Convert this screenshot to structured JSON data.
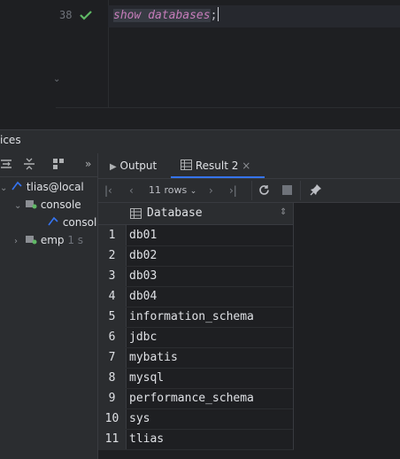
{
  "editor": {
    "line_number": "38",
    "code_keyword": "show databases",
    "code_semicolon": ";"
  },
  "services": {
    "title": "ices",
    "tree": [
      {
        "label": "tlias@local",
        "icon": "connection-icon"
      },
      {
        "label": "console",
        "icon": "console-icon"
      },
      {
        "label": "consol",
        "icon": "console-leaf-icon"
      },
      {
        "label": "emp",
        "icon": "console-icon",
        "status": "1 s"
      }
    ]
  },
  "tabs": {
    "output": "Output",
    "result": "Result 2"
  },
  "grid_toolbar": {
    "rows_label": "11 rows"
  },
  "grid": {
    "column": "Database",
    "rows": [
      {
        "n": "1",
        "v": "db01"
      },
      {
        "n": "2",
        "v": "db02"
      },
      {
        "n": "3",
        "v": "db03"
      },
      {
        "n": "4",
        "v": "db04"
      },
      {
        "n": "5",
        "v": "information_schema"
      },
      {
        "n": "6",
        "v": "jdbc"
      },
      {
        "n": "7",
        "v": "mybatis"
      },
      {
        "n": "8",
        "v": "mysql"
      },
      {
        "n": "9",
        "v": "performance_schema"
      },
      {
        "n": "10",
        "v": "sys"
      },
      {
        "n": "11",
        "v": "tlias"
      }
    ]
  },
  "colors": {
    "accent": "#3574f0",
    "check": "#5fb865",
    "keyword": "#c77dbb"
  }
}
